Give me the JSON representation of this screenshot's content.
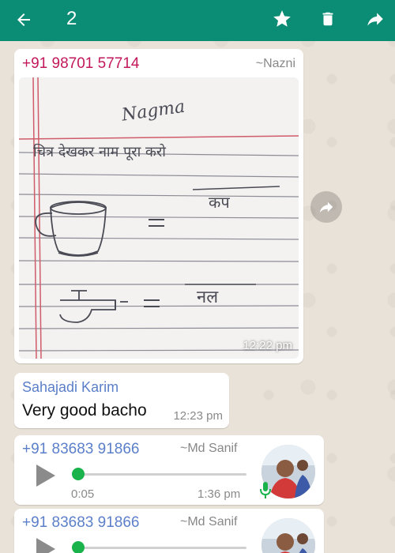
{
  "topbar": {
    "selected_count": "2",
    "back_icon": "arrow-left-icon",
    "star_icon": "star-icon",
    "delete_icon": "trash-icon",
    "forward_icon": "forward-icon"
  },
  "messages": [
    {
      "type": "image",
      "sender": "+91 98701 57714",
      "pushname": "~Nazni",
      "time": "12:22 pm",
      "image_text": {
        "name": "Nagma",
        "heading": "चित्र देखकर नाम पूरा करो",
        "word1": "कप",
        "word2": "नल"
      }
    },
    {
      "type": "text",
      "sender": "Sahajadi Karim",
      "body": "Very good bacho",
      "time": "12:23 pm"
    },
    {
      "type": "voice",
      "sender": "+91 83683 91866",
      "pushname": "~Md Sanif",
      "duration": "0:05",
      "time": "1:36 pm"
    },
    {
      "type": "voice",
      "sender": "+91 83683 91866",
      "pushname": "~Md Sanif"
    }
  ],
  "colors": {
    "topbar": "#0b8c74",
    "sender_pink": "#c2185b",
    "sender_blue": "#5b7fc9",
    "voice_green": "#19b24b"
  }
}
